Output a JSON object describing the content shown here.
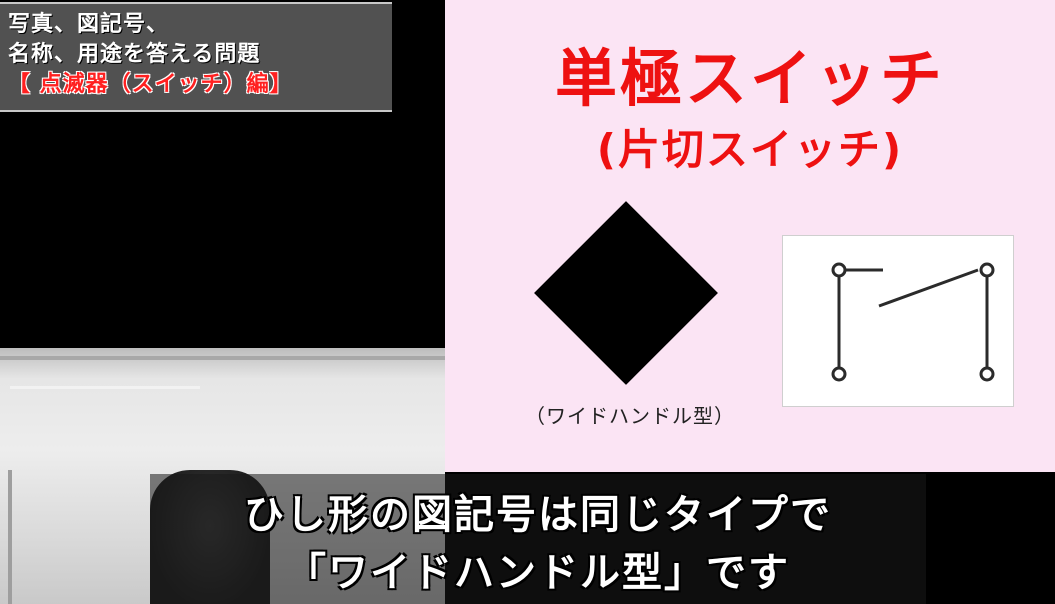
{
  "title_box": {
    "line1": "写真、図記号、",
    "line2": "名称、用途を答える問題",
    "line3": "【 点滅器（スイッチ）編】"
  },
  "slide": {
    "title": "単極スイッチ",
    "subtitle": "(片切スイッチ)",
    "diamond_caption": "（ワイドハンドル型）",
    "colors": {
      "background": "#fbe4f4",
      "title": "#ee1111",
      "symbol": "#000000"
    }
  },
  "subtitles": {
    "line1": "ひし形の図記号は同じタイプで",
    "line2": "「ワイドハンドル型」です"
  }
}
